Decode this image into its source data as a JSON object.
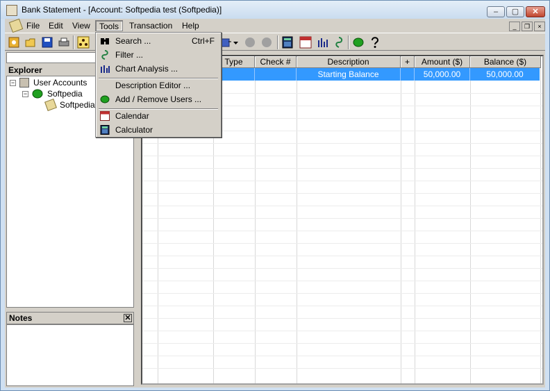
{
  "window": {
    "title": "Bank Statement - [Account: Softpedia test (Softpedia)]",
    "caption_minimize": "‒",
    "caption_maximize": "▢",
    "caption_close": "✕"
  },
  "menubar": {
    "items": [
      {
        "label": "File"
      },
      {
        "label": "Edit"
      },
      {
        "label": "View"
      },
      {
        "label": "Tools"
      },
      {
        "label": "Transaction"
      },
      {
        "label": "Help"
      }
    ],
    "active": "Tools",
    "mdi_minimize": "_",
    "mdi_restore": "❐",
    "mdi_close": "×"
  },
  "toolbar": {
    "icons": [
      "new-account-icon",
      "open-icon",
      "save-icon",
      "print-icon",
      "users-icon",
      "import-icon",
      "record-icon",
      "record2-icon",
      "calculator-icon",
      "calendar-icon",
      "chart-icon",
      "filter-icon",
      "turtle-icon",
      "help-icon"
    ]
  },
  "explorer": {
    "title": "Explorer",
    "tree": [
      {
        "label": "User Accounts",
        "level": 0,
        "expander": "−"
      },
      {
        "label": "Softpedia",
        "level": 1,
        "expander": "−"
      },
      {
        "label": "Softpedia",
        "level": 2,
        "expander": ""
      }
    ]
  },
  "notes": {
    "title": "Notes",
    "close": "✕"
  },
  "grid": {
    "columns": [
      "Type",
      "Check #",
      "Description",
      "+",
      "Amount ($)",
      "Balance ($)"
    ],
    "rows": [
      {
        "type": "",
        "check": "",
        "description": "Starting Balance",
        "plus": "",
        "amount": "50,000.00",
        "balance": "50,000.00"
      }
    ]
  },
  "tools_menu": {
    "items": [
      {
        "label": "Search ...",
        "shortcut": "Ctrl+F",
        "icon": "binoculars-icon"
      },
      {
        "label": "Filter ...",
        "shortcut": "",
        "icon": "filter-icon"
      },
      {
        "label": "Chart Analysis ...",
        "shortcut": "",
        "icon": "chart-icon"
      },
      {
        "label": "Description Editor ...",
        "shortcut": "",
        "icon": ""
      },
      {
        "label": "Add / Remove Users ...",
        "shortcut": "",
        "icon": "turtle-icon"
      },
      {
        "label": "Calendar",
        "shortcut": "",
        "icon": "calendar-icon"
      },
      {
        "label": "Calculator",
        "shortcut": "",
        "icon": "calculator-icon"
      }
    ]
  },
  "colors": {
    "selection": "#3399ff",
    "chrome": "#d4d0c8",
    "title_bar": "#cfe0f2"
  }
}
